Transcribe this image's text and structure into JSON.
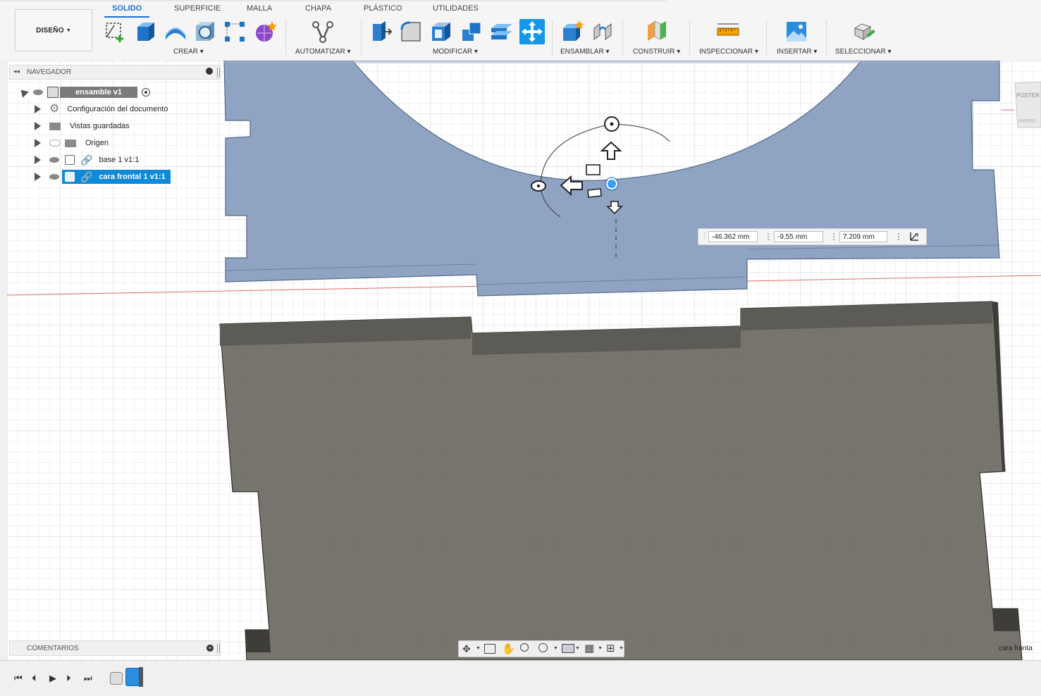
{
  "workspace": {
    "label": "DISEÑO"
  },
  "tabs": [
    {
      "label": "SOLIDO",
      "active": true
    },
    {
      "label": "SUPERFICIE"
    },
    {
      "label": "MALLA"
    },
    {
      "label": "CHAPA"
    },
    {
      "label": "PLÁSTICO"
    },
    {
      "label": "UTILIDADES"
    }
  ],
  "groups": {
    "crear": "CREAR",
    "automatizar": "AUTOMATIZAR",
    "modificar": "MODIFICAR",
    "ensamblar": "ENSAMBLAR",
    "construir": "CONSTRUIR",
    "inspeccionar": "INSPECCIONAR",
    "insertar": "INSERTAR",
    "seleccionar": "SELECCIONAR"
  },
  "navigator": {
    "title": "NAVEGADOR",
    "items": [
      {
        "label": "ensamble v1"
      },
      {
        "label": "Configuración del documento"
      },
      {
        "label": "Vistas guardadas"
      },
      {
        "label": "Origen"
      },
      {
        "label": "base 1 v1:1"
      },
      {
        "label": "cara frontal 1 v1:1"
      }
    ]
  },
  "comments": {
    "title": "COMENTARIOS"
  },
  "coords": {
    "x": "-46.362 mm",
    "y": "-9.55 mm",
    "z": "7.209 mm"
  },
  "viewcube": {
    "top": "POSTER",
    "bottom": "INFERI"
  },
  "body_label": "cara fronta",
  "colors": {
    "accent": "#1d6fd6",
    "selected": "#0f8ad8",
    "blue_body": "#8fa3c2",
    "grey_body": "#77756d"
  }
}
